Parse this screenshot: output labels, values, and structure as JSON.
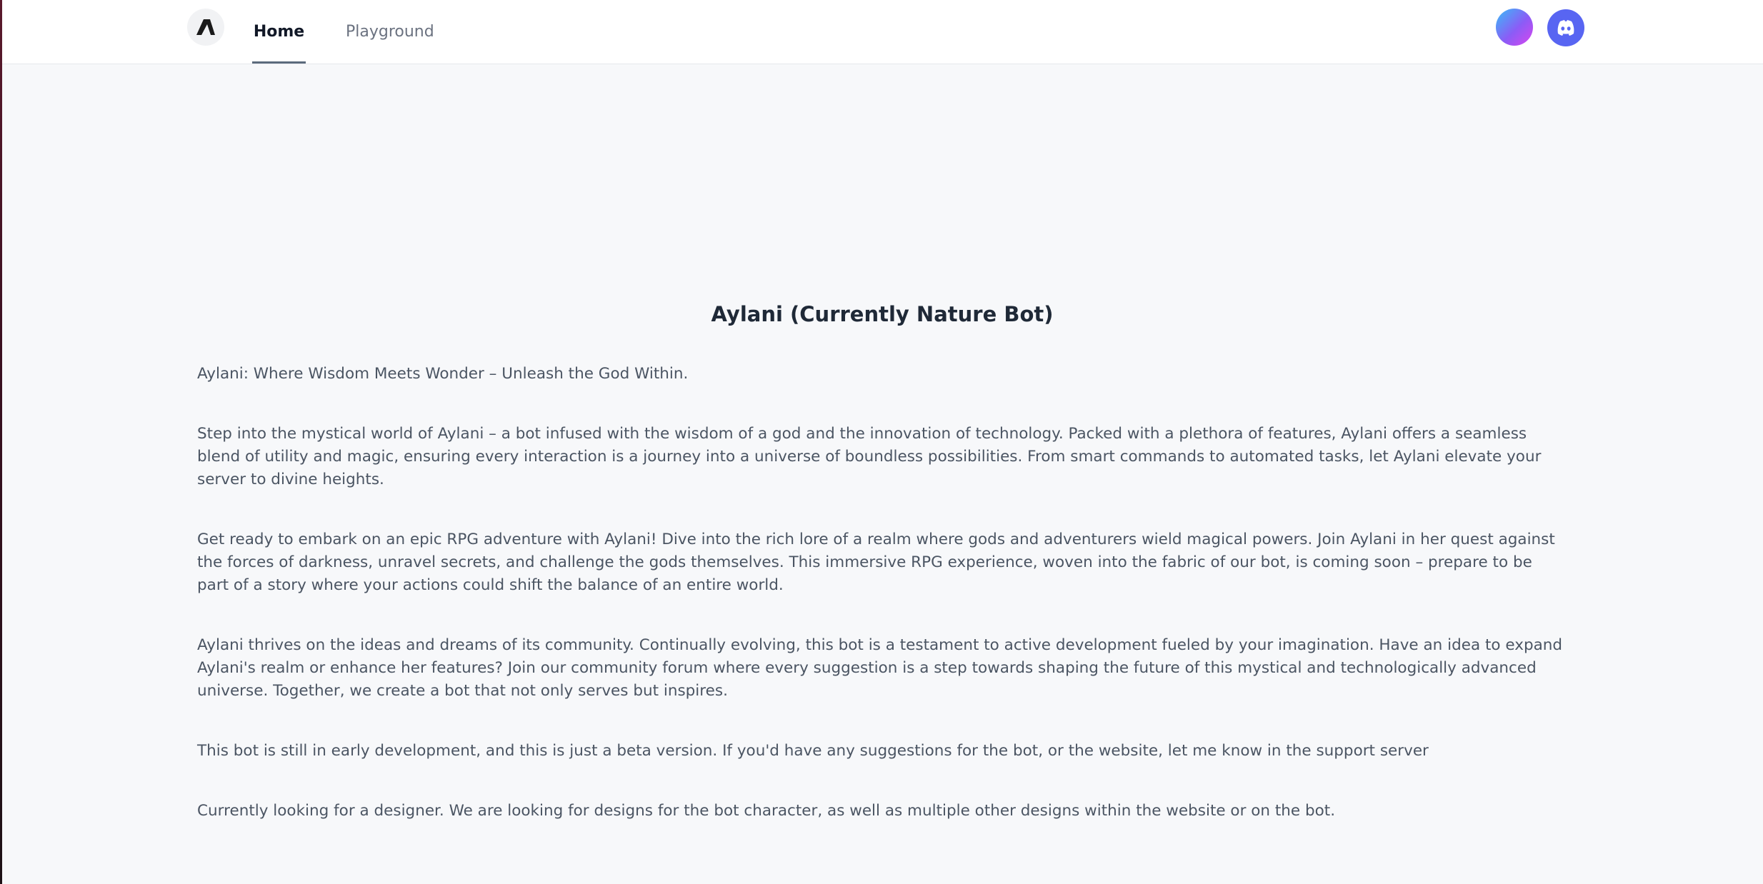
{
  "nav": {
    "tabs": [
      {
        "label": "Home",
        "active": true
      },
      {
        "label": "Playground",
        "active": false
      }
    ],
    "logo_icon": "aylani-logo-icon",
    "avatar_icon": "user-avatar-icon",
    "discord_icon": "discord-icon"
  },
  "colors": {
    "background": "#f7f8fa",
    "navbar": "#ffffff",
    "discord": "#5865f2",
    "active_tab_underline": "#5b6b7c"
  },
  "main": {
    "title": "Aylani (Currently Nature Bot)",
    "paragraphs": [
      "Aylani: Where Wisdom Meets Wonder – Unleash the God Within.",
      "Step into the mystical world of Aylani – a bot infused with the wisdom of a god and the innovation of technology. Packed with a plethora of features, Aylani offers a seamless blend of utility and magic, ensuring every interaction is a journey into a universe of boundless possibilities. From smart commands to automated tasks, let Aylani elevate your server to divine heights.",
      "Get ready to embark on an epic RPG adventure with Aylani! Dive into the rich lore of a realm where gods and adventurers wield magical powers. Join Aylani in her quest against the forces of darkness, unravel secrets, and challenge the gods themselves. This immersive RPG experience, woven into the fabric of our bot, is coming soon – prepare to be part of a story where your actions could shift the balance of an entire world.",
      "Aylani thrives on the ideas and dreams of its community. Continually evolving, this bot is a testament to active development fueled by your imagination. Have an idea to expand Aylani's realm or enhance her features? Join our community forum where every suggestion is a step towards shaping the future of this mystical and technologically advanced universe. Together, we create a bot that not only serves but inspires.",
      "This bot is still in early development, and this is just a beta version. If you'd have any suggestions for the bot, or the website, let me know in the support server",
      "Currently looking for a designer. We are looking for designs for the bot character, as well as multiple other designs within the website or on the bot."
    ]
  }
}
